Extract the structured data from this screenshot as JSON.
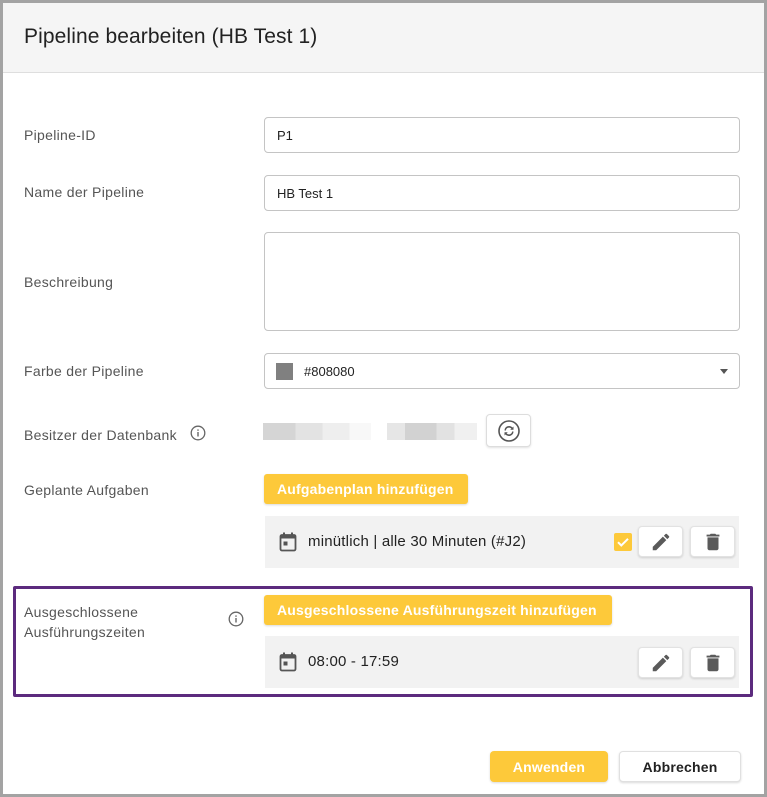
{
  "dialog": {
    "title": "Pipeline bearbeiten (HB Test 1)"
  },
  "fields": {
    "pipeline_id": {
      "label": "Pipeline-ID",
      "value": "P1"
    },
    "name": {
      "label": "Name der Pipeline",
      "value": "HB Test 1"
    },
    "description": {
      "label": "Beschreibung",
      "value": ""
    },
    "color": {
      "label": "Farbe der Pipeline",
      "value": "#808080"
    },
    "owner": {
      "label": "Besitzer der Datenbank"
    }
  },
  "scheduled": {
    "label": "Geplante Aufgaben",
    "add_label": "Aufgabenplan hinzufügen",
    "item_text": "minütlich | alle 30 Minuten (#J2)",
    "item_checked": true
  },
  "excluded": {
    "label_line1": "Ausgeschlossene",
    "label_line2": "Ausführungszeiten",
    "add_label": "Ausgeschlossene Ausführungszeit hinzufügen",
    "item_text": "08:00 - 17:59"
  },
  "footer": {
    "apply_label": "Anwenden",
    "cancel_label": "Abbrechen"
  },
  "colors": {
    "accent": "#fdc93a",
    "highlight": "#5c2a7e",
    "swatch": "#808080"
  }
}
